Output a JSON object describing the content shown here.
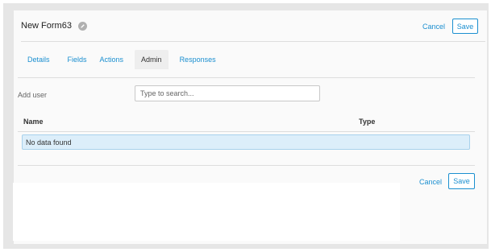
{
  "header": {
    "title": "New Form63",
    "cancel_label": "Cancel",
    "save_label": "Save"
  },
  "tabs": [
    {
      "label": "Details",
      "active": false
    },
    {
      "label": "Fields",
      "active": false
    },
    {
      "label": "Actions",
      "active": false
    },
    {
      "label": "Admin",
      "active": true
    },
    {
      "label": "Responses",
      "active": false
    }
  ],
  "admin": {
    "add_user_label": "Add user",
    "search_placeholder": "Type to search...",
    "columns": [
      "Name",
      "Type"
    ],
    "empty_message": "No data found"
  },
  "footer": {
    "cancel_label": "Cancel",
    "save_label": "Save"
  },
  "icons": {
    "edit": "pencil-icon"
  },
  "colors": {
    "accent": "#1b8fd0",
    "empty_row_bg": "#dceefa"
  }
}
